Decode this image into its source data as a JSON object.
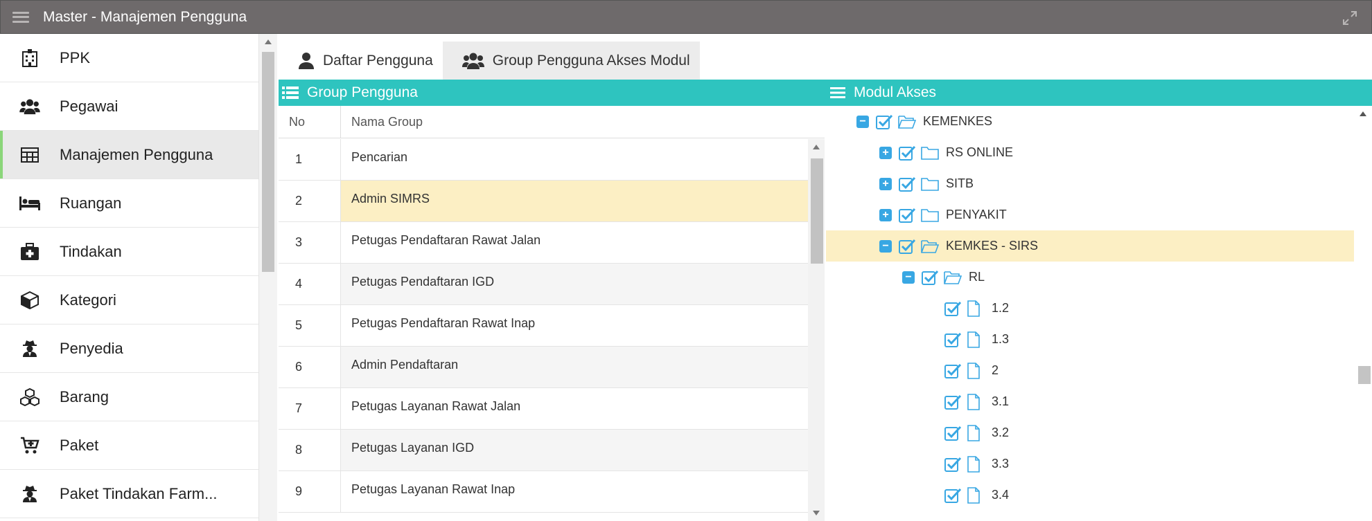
{
  "window": {
    "title": "Master - Manajemen Pengguna"
  },
  "sidebar": {
    "items": [
      {
        "label": "PPK",
        "icon": "hospital-icon"
      },
      {
        "label": "Pegawai",
        "icon": "users-icon"
      },
      {
        "label": "Manajemen Pengguna",
        "icon": "table-icon",
        "active": true
      },
      {
        "label": "Ruangan",
        "icon": "bed-icon"
      },
      {
        "label": "Tindakan",
        "icon": "medkit-icon"
      },
      {
        "label": "Kategori",
        "icon": "cube-icon"
      },
      {
        "label": "Penyedia",
        "icon": "user-secret-icon"
      },
      {
        "label": "Barang",
        "icon": "cubes-icon"
      },
      {
        "label": "Paket",
        "icon": "cart-plus-icon"
      },
      {
        "label": "Paket Tindakan Farm...",
        "icon": "user-secret-icon"
      }
    ]
  },
  "tabs": [
    {
      "label": "Daftar Pengguna",
      "icon": "user-icon",
      "active": false
    },
    {
      "label": "Group Pengguna Akses Modul",
      "icon": "users-icon",
      "active": true
    }
  ],
  "group_panel": {
    "title": "Group Pengguna",
    "columns": {
      "no": "No",
      "name": "Nama Group"
    },
    "rows": [
      {
        "no": "1",
        "name": "Pencarian"
      },
      {
        "no": "2",
        "name": "Admin SIMRS"
      },
      {
        "no": "3",
        "name": "Petugas Pendaftaran Rawat Jalan"
      },
      {
        "no": "4",
        "name": "Petugas Pendaftaran IGD"
      },
      {
        "no": "5",
        "name": "Petugas Pendaftaran Rawat Inap"
      },
      {
        "no": "6",
        "name": "Admin Pendaftaran"
      },
      {
        "no": "7",
        "name": "Petugas Layanan Rawat Jalan"
      },
      {
        "no": "8",
        "name": "Petugas Layanan IGD"
      },
      {
        "no": "9",
        "name": "Petugas Layanan Rawat Inap"
      }
    ],
    "selected_row": 1
  },
  "modul_panel": {
    "title": "Modul Akses",
    "nodes": [
      {
        "label": "KEMENKES",
        "level": 0,
        "expander": "minus",
        "type": "folder-open",
        "checked": true
      },
      {
        "label": "RS ONLINE",
        "level": 1,
        "expander": "plus",
        "type": "folder",
        "checked": true
      },
      {
        "label": "SITB",
        "level": 1,
        "expander": "plus",
        "type": "folder",
        "checked": true
      },
      {
        "label": "PENYAKIT",
        "level": 1,
        "expander": "plus",
        "type": "folder",
        "checked": true
      },
      {
        "label": "KEMKES - SIRS",
        "level": 1,
        "expander": "minus",
        "type": "folder-open",
        "checked": true,
        "selected": true
      },
      {
        "label": "RL",
        "level": 2,
        "expander": "minus",
        "type": "folder-open",
        "checked": true
      },
      {
        "label": "1.2",
        "level": 3,
        "expander": "none",
        "type": "file",
        "checked": true
      },
      {
        "label": "1.3",
        "level": 3,
        "expander": "none",
        "type": "file",
        "checked": true
      },
      {
        "label": "2",
        "level": 3,
        "expander": "none",
        "type": "file",
        "checked": true
      },
      {
        "label": "3.1",
        "level": 3,
        "expander": "none",
        "type": "file",
        "checked": true
      },
      {
        "label": "3.2",
        "level": 3,
        "expander": "none",
        "type": "file",
        "checked": true
      },
      {
        "label": "3.3",
        "level": 3,
        "expander": "none",
        "type": "file",
        "checked": true
      },
      {
        "label": "3.4",
        "level": 3,
        "expander": "none",
        "type": "file",
        "checked": true
      }
    ]
  },
  "colors": {
    "accent": "#2ec4bf",
    "selection": "#fcefc4",
    "active_bar": "#8bd67a",
    "tree_icon": "#38a7e3",
    "titlebar": "#6e6a6b"
  }
}
